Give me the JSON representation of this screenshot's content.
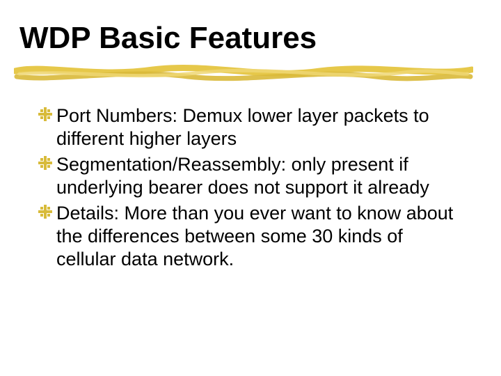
{
  "slide": {
    "title": "WDP Basic Features",
    "bullets": [
      {
        "text": "Port Numbers: Demux lower layer packets to different higher layers"
      },
      {
        "text": "Segmentation/Reassembly: only present if underlying bearer does not support it already"
      },
      {
        "text": "Details: More than you ever want to know about the differences between some 30 kinds of cellular data network."
      }
    ],
    "colors": {
      "accent": "#e6c84a",
      "accent_dark": "#c9a92b",
      "bullet": "#d8bb3a"
    }
  }
}
